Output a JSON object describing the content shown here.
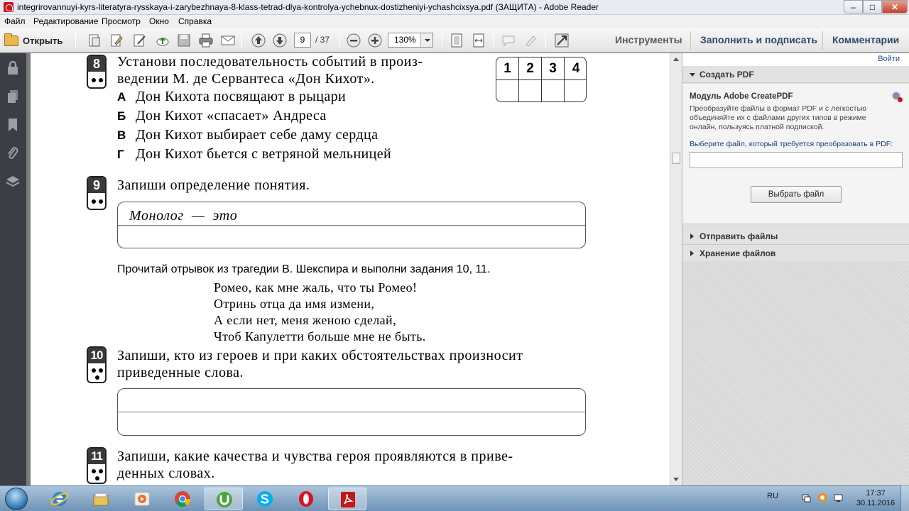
{
  "window": {
    "title": "integrirovannuyi-kyrs-literatyra-rysskaya-i-zarybezhnaya-8-klass-tetrad-dlya-kontrolya-ychebnux-dostizheniyi-ychashcixsya.pdf (ЗАЩИТА) - Adobe Reader",
    "min": "–",
    "max": "□",
    "close": "✕"
  },
  "menu": [
    "Файл",
    "Редактирование",
    "Просмотр",
    "Окно",
    "Справка"
  ],
  "toolbar": {
    "open_label": "Открыть",
    "page_current": "9",
    "page_total": "/ 37",
    "zoom": "130%",
    "tools_label": "Инструменты",
    "fill_sign_label": "Заполнить и подписать",
    "comments_label": "Комментарии"
  },
  "document": {
    "q8": {
      "number": "8",
      "line1": "Установи последовательность событий в произ-",
      "line2": "ведении М. де Сервантеса «Дон Кихот».",
      "grid_headers": [
        "1",
        "2",
        "3",
        "4"
      ],
      "options": [
        {
          "letter": "А",
          "text": "Дон Кихота посвящают в рыцари"
        },
        {
          "letter": "Б",
          "text": "Дон Кихот «спасает» Андреса"
        },
        {
          "letter": "В",
          "text": "Дон Кихот выбирает себе даму сердца"
        },
        {
          "letter": "Г",
          "text": "Дон Кихот бьется с ветряной мельницей"
        }
      ]
    },
    "q9": {
      "number": "9",
      "text": "Запиши определение понятия.",
      "prompt": "Монолог  —  это"
    },
    "intro": "Прочитай отрывок из трагедии В. Шекспира и выполни задания 10, 11.",
    "verse": [
      "Ромео, как мне жаль, что ты Ромео!",
      "Отринь отца да имя измени,",
      "А если нет, меня женою сделай,",
      "Чтоб Капулетти больше мне не быть."
    ],
    "q10": {
      "number": "10",
      "line1": "Запиши, кто из героев и при каких обстоятельствах произносит",
      "line2": "приведенные слова."
    },
    "q11": {
      "number": "11",
      "line1": "Запиши, какие качества и чувства героя проявляются в приве-",
      "line2": "денных словах."
    }
  },
  "right_pane": {
    "login": "Войти",
    "create_pdf": "Создать PDF",
    "module_title": "Модуль Adobe CreatePDF",
    "module_desc": "Преобразуйте файлы в формат PDF и с легкостью объединяйте их с файлами других типов в режиме онлайн, пользуясь платной подпиской.",
    "choose_label": "Выберите файл, который требуется преобразовать в PDF:",
    "choose_button": "Выбрать файл",
    "send_files": "Отправить файлы",
    "store_files": "Хранение файлов"
  },
  "taskbar": {
    "lang": "RU",
    "time": "17:37",
    "date": "30.11.2016",
    "apps": [
      "internet-explorer",
      "file-explorer",
      "media-player",
      "chrome",
      "utorrent",
      "skype",
      "opera",
      "adobe-reader"
    ]
  }
}
